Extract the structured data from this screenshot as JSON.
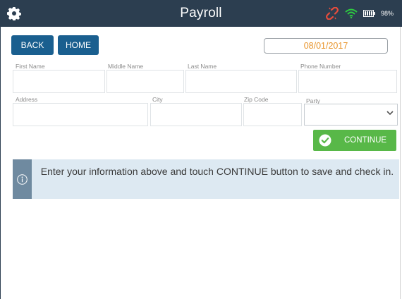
{
  "header": {
    "title": "Payroll",
    "battery_percent": "98%",
    "icons": {
      "settings": "gear-icon",
      "link": "broken-link-icon",
      "wifi": "wifi-icon",
      "battery": "battery-icon"
    },
    "colors": {
      "bar": "#2c3e50",
      "link": "#e74c3c",
      "wifi": "#2ecc40"
    }
  },
  "nav": {
    "back_label": "BACK",
    "home_label": "HOME",
    "date": "08/01/2017"
  },
  "form": {
    "first_name": {
      "label": "First Name",
      "value": ""
    },
    "middle_name": {
      "label": "Middle Name",
      "value": ""
    },
    "last_name": {
      "label": "Last Name",
      "value": ""
    },
    "phone": {
      "label": "Phone Number",
      "value": ""
    },
    "address": {
      "label": "Address",
      "value": ""
    },
    "city": {
      "label": "City",
      "value": ""
    },
    "zip": {
      "label": "Zip Code",
      "value": ""
    },
    "party": {
      "label": "Party",
      "selected": ""
    }
  },
  "continue_label": "CONTINUE",
  "info": {
    "text": "Enter your information above and touch CONTINUE button to save and check in."
  },
  "colors": {
    "button": "#1a5f8f",
    "continue": "#58b848",
    "date_text": "#e8942a",
    "info_bg": "#dde9f2"
  }
}
